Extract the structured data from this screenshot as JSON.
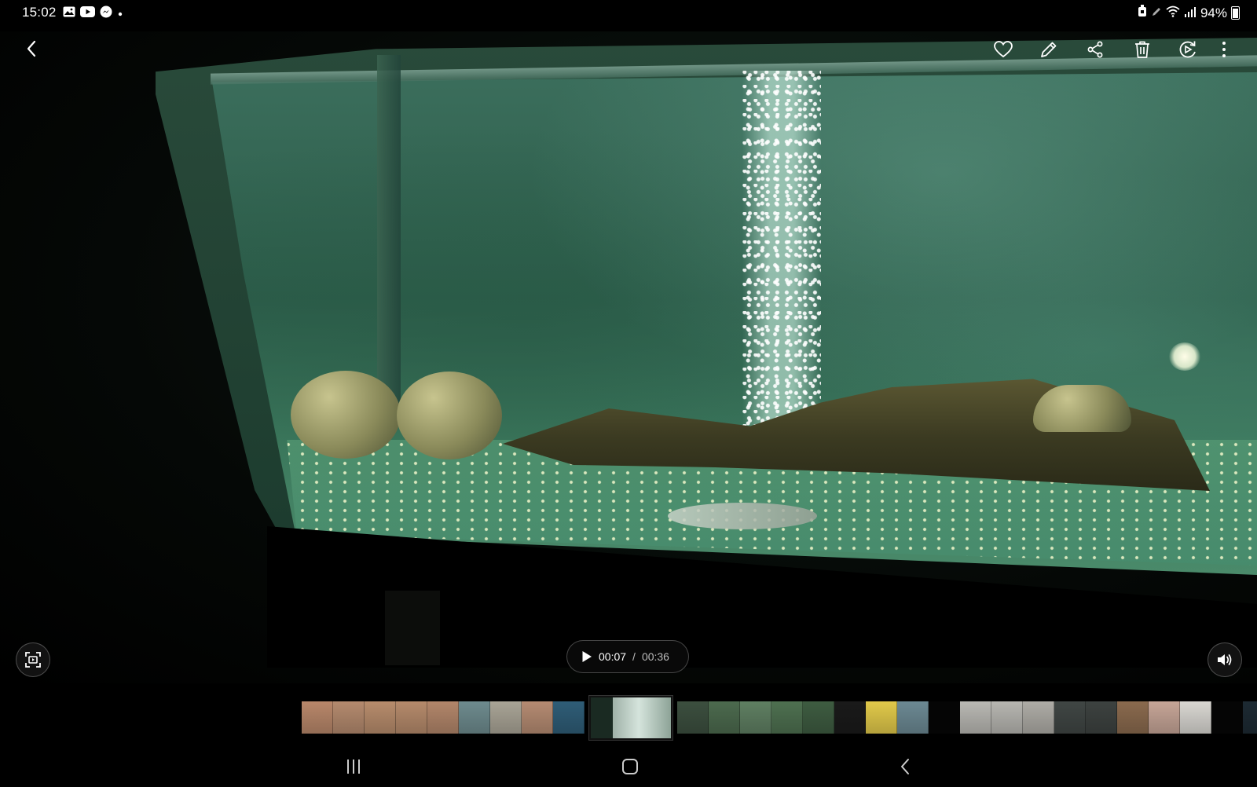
{
  "status_bar": {
    "time": "15:02",
    "left_icons": [
      "gallery-icon",
      "youtube-icon",
      "messenger-icon",
      "notification-dot-icon"
    ],
    "right_icons": [
      "nfc-icon",
      "pen-icon",
      "wifi-icon",
      "signal-icon",
      "battery-icon"
    ],
    "battery_percent": "94%"
  },
  "toolbar": {
    "actions": [
      "back",
      "favorite",
      "edit",
      "share",
      "delete",
      "remaster",
      "more-options"
    ]
  },
  "player": {
    "current_time": "00:07",
    "separator": "/",
    "total_time": "00:36",
    "state": "paused"
  },
  "filmstrip": {
    "thumbnail_colors": [
      "#b8876a",
      "#b48a6e",
      "#b78c6c",
      "#b58a6b",
      "#b2866a",
      "#6e8b8e",
      "#a9a496",
      "#b58b72",
      "#2f5d77",
      "ACTIVE",
      "#3c4f3f",
      "#4c6a4e",
      "#5f7f62",
      "#4e7050",
      "#3e5c41",
      "#1a1a1a",
      "#e1c94a",
      "#6c8993",
      "GAP",
      "#b9b8b3",
      "#b7b6b1",
      "#aeaca6",
      "#404644",
      "#3d4240",
      "#8a6a4e",
      "#c6a597",
      "#d9d7d2",
      "GAP",
      "#1d2a33"
    ],
    "active_index": 9
  },
  "nav_bar": {
    "buttons": [
      "recents",
      "home",
      "back"
    ]
  },
  "colors": {
    "background": "#000000",
    "control_bg": "#141414",
    "text_primary": "#ffffff",
    "text_secondary": "#bbbbbb"
  }
}
